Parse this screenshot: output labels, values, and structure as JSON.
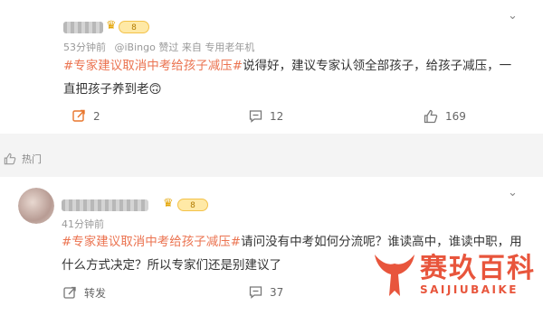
{
  "post1": {
    "meta_time": "53分钟前",
    "meta_source": "@iBingo 赞过  来自 专用老年机",
    "vip_badge": "8",
    "body_tag": "#专家建议取消中考给孩子减压#",
    "body_text": "说得好，建议专家认领全部孩子，给孩子减压，一直把孩子养到老",
    "emoji": "🙃",
    "repost_count": "2",
    "comment_count": "12",
    "like_count": "169"
  },
  "hot_label": "热门",
  "post2": {
    "meta_time": "41分钟前",
    "vip_badge": "8",
    "body_tag": "#专家建议取消中考给孩子减压#",
    "body_text": "请问没有中考如何分流呢？谁读高中，谁读中职，用什么方式决定？所以专家们还是别建议了",
    "repost_label": "转发",
    "comment_count": "37"
  },
  "watermark": {
    "cn": "赛玖百科",
    "en": "SAIJIUBAIKE"
  },
  "colors": {
    "tag": "#eb7350",
    "repost_icon": "#e8762d",
    "watermark": "#e8553c"
  }
}
